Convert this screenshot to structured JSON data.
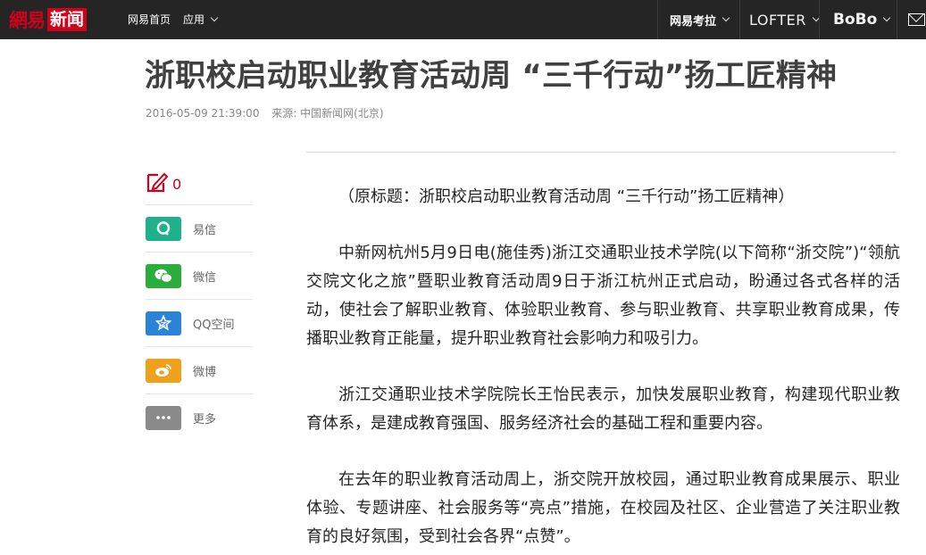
{
  "topnav": {
    "logo_part1": "網易",
    "logo_part2": "新闻",
    "home": "网易首页",
    "apps": "应用",
    "kaola": "网易考拉",
    "lofter": "LOFTER",
    "bobo": "BoBo"
  },
  "article": {
    "title": "浙职校启动职业教育活动周 “三千行动”扬工匠精神",
    "datetime": "2016-05-09 21:39:00",
    "source": "来源: 中国新闻网(北京)",
    "paragraphs": [
      "（原标题：浙职校启动职业教育活动周 “三千行动”扬工匠精神）",
      "中新网杭州5月9日电(施佳秀)浙江交通职业技术学院(以下简称“浙交院”)“领航交院文化之旅”暨职业教育活动周9日于浙江杭州正式启动，盼通过各式各样的活动，使社会了解职业教育、体验职业教育、参与职业教育、共享职业教育成果，传播职业教育正能量，提升职业教育社会影响力和吸引力。",
      "浙江交通职业技术学院院长王怡民表示，加快发展职业教育，构建现代职业教育体系，是建成教育强国、服务经济社会的基础工程和重要内容。",
      "在去年的职业教育活动周上，浙交院开放校园，通过职业教育成果展示、职业体验、专题讲座、社会服务等“亮点”措施，在校园及社区、企业营造了关注职业教育的良好氛围，受到社会各界“点赞”。"
    ]
  },
  "share": {
    "comment_count": "0",
    "items": [
      {
        "label": "易信",
        "icon": "yixin-icon",
        "color": "#1fb28a"
      },
      {
        "label": "微信",
        "icon": "wechat-icon",
        "color": "#2bad3b"
      },
      {
        "label": "QQ空间",
        "icon": "qzone-icon",
        "color": "#2a83d6"
      },
      {
        "label": "微博",
        "icon": "weibo-icon",
        "color": "#f0a11c"
      },
      {
        "label": "更多",
        "icon": "more-icon",
        "color": "#8a8a8a"
      }
    ]
  },
  "colors": {
    "brand_red": "#d0021b",
    "topbar": "#252525"
  }
}
